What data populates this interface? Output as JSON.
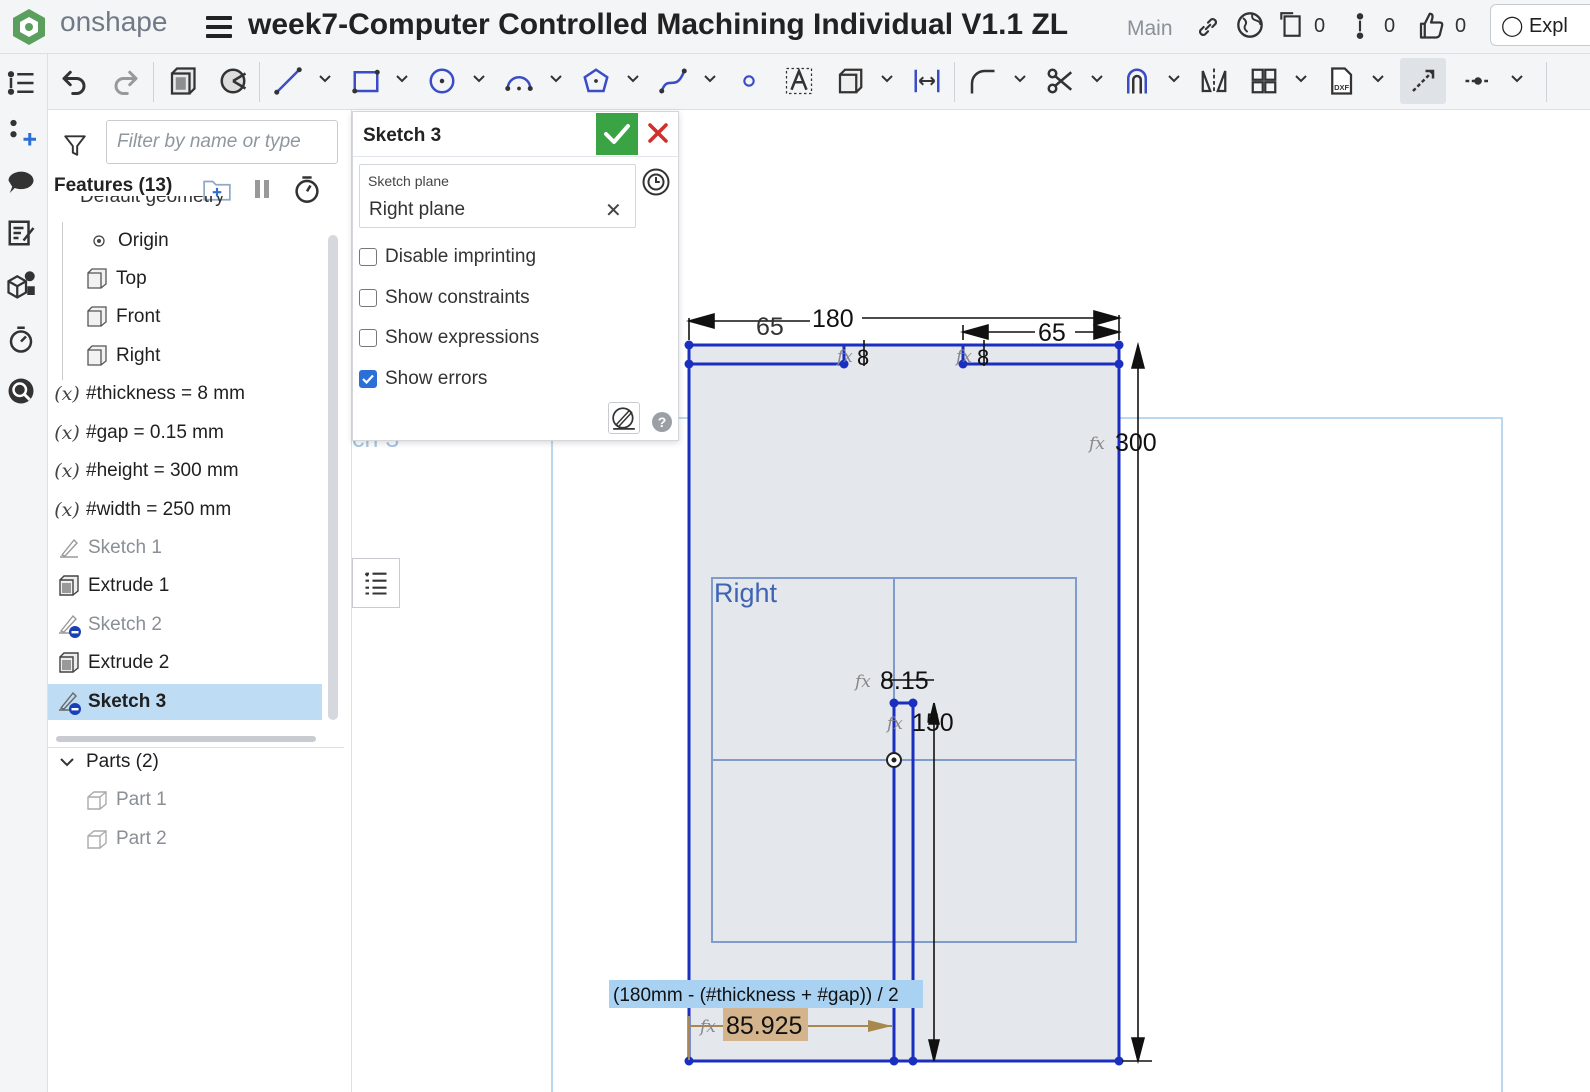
{
  "app": {
    "logo": "onshape",
    "doc_title": "week7-Computer Controlled Machining Individual V1.1 ZL",
    "branch": "Main",
    "versions_count": "0",
    "branches_count": "0",
    "likes_count": "0",
    "explore_label": "Expl"
  },
  "feature_panel": {
    "filter_placeholder": "Filter by name or type",
    "features_header": "Features (13)",
    "cut_item": "Default geometry",
    "items": [
      {
        "label": "Origin",
        "icon": "origin-icon"
      },
      {
        "label": "Top",
        "icon": "plane-icon"
      },
      {
        "label": "Front",
        "icon": "plane-icon"
      },
      {
        "label": "Right",
        "icon": "plane-icon"
      },
      {
        "label": "#thickness = 8 mm",
        "icon": "variable-icon"
      },
      {
        "label": "#gap = 0.15 mm",
        "icon": "variable-icon"
      },
      {
        "label": "#height = 300 mm",
        "icon": "variable-icon"
      },
      {
        "label": "#width = 250 mm",
        "icon": "variable-icon"
      },
      {
        "label": "Sketch 1",
        "icon": "sketch-icon"
      },
      {
        "label": "Extrude 1",
        "icon": "extrude-icon"
      },
      {
        "label": "Sketch 2",
        "icon": "sketch-icon"
      },
      {
        "label": "Extrude 2",
        "icon": "extrude-icon"
      },
      {
        "label": "Sketch 3",
        "icon": "sketch-icon"
      }
    ],
    "parts_header": "Parts (2)",
    "parts": [
      "Part 1",
      "Part 2"
    ]
  },
  "sketch_dialog": {
    "title": "Sketch 3",
    "plane_label": "Sketch plane",
    "plane_value": "Right plane",
    "options": [
      {
        "label": "Disable imprinting",
        "checked": false
      },
      {
        "label": "Show constraints",
        "checked": false
      },
      {
        "label": "Show expressions",
        "checked": false
      },
      {
        "label": "Show errors",
        "checked": true
      }
    ]
  },
  "canvas": {
    "ghost_text": "ch 3",
    "plane_label": "Right",
    "dims": {
      "top_180": "180",
      "top_65_left": "65",
      "top_65_right": "65",
      "thk_left": "8",
      "thk_right": "8",
      "height": "300",
      "gap": "8.15",
      "slot": "150",
      "edit_expression": "(180mm - (#thickness + #gap)) / 2",
      "edit_value": "85.925"
    },
    "fx_symbol": "fx"
  },
  "colors": {
    "sketch_blue": "#1a2fbf",
    "plane_blue": "#7f9ccc",
    "ok_green": "#3aa344",
    "cancel_red": "#d0312d",
    "selection_blue": "#bfdcf5",
    "dim_edit_tan": "#d4b48c",
    "expression_bg": "#a9d2f2"
  }
}
